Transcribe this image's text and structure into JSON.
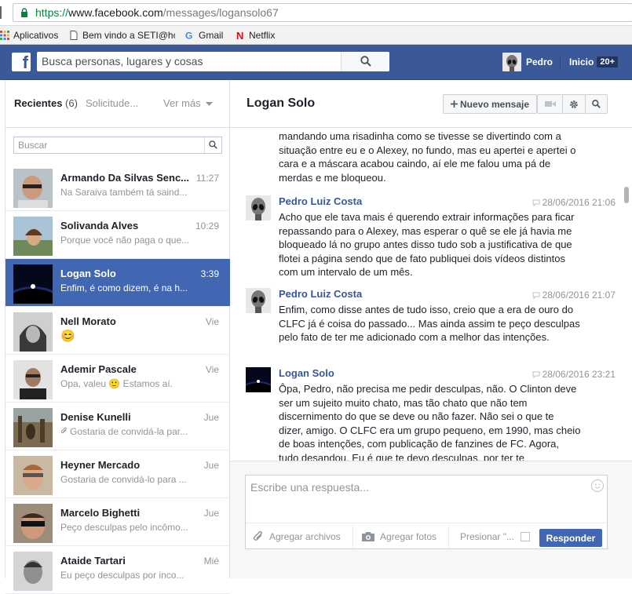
{
  "browser": {
    "url_scheme": "https://",
    "url_host": "www.facebook.com",
    "url_path": "/messages/logansolo67",
    "bookmarks": [
      "Aplicativos",
      "Bem vindo a SETI@hc",
      "Gmail",
      "Netflix"
    ]
  },
  "fb": {
    "search_placeholder": "Busca personas, lugares y cosas",
    "user_name": "Pedro",
    "home_label": "Inicio",
    "home_badge": "20+"
  },
  "left": {
    "tab_recent": "Recientes",
    "tab_recent_count": "(6)",
    "tab_requests": "Solicitude...",
    "tab_more": "Ver más",
    "search_placeholder": "Buscar",
    "threads": [
      {
        "name": "Armando Da Silvas Senc...",
        "time": "11:27",
        "snippet": "Na Saraiva também tá saind..."
      },
      {
        "name": "Solivanda Alves",
        "time": "10:29",
        "snippet": "Porque você não paga o que..."
      },
      {
        "name": "Logan Solo",
        "time": "3:39",
        "snippet": "Enfim, é como dizem, é na h..."
      },
      {
        "name": "Nell Morato",
        "time": "Vie",
        "snippet": "😊"
      },
      {
        "name": "Ademir Pascale",
        "time": "Vie",
        "snippet": "Opa, valeu 🙂 Estamos aí."
      },
      {
        "name": "Denise Kunelli",
        "time": "Jue",
        "snippet": "Gostaria de convidá-la par..."
      },
      {
        "name": "Heyner Mercado",
        "time": "Jue",
        "snippet": "Gostaria de convidá-lo para ..."
      },
      {
        "name": "Marcelo Bighetti",
        "time": "Jue",
        "snippet": "Peço desculpas pelo incômo..."
      },
      {
        "name": "Ataide Tartari",
        "time": "Mié",
        "snippet": "Eu peço desculpas por inco..."
      }
    ]
  },
  "convo": {
    "title": "Logan Solo",
    "new_message": "Nuevo mensaje",
    "messages": [
      {
        "sender": "",
        "time": "",
        "text": "mandando uma risadinha como se tivesse se divertindo com a situação entre eu e o Alexey, no fundo, mas eu apertei e apertei o cara e a máscara acabou caindo, aí ele me falou uma pá de merdas e me bloqueou."
      },
      {
        "sender": "Pedro Luiz Costa",
        "time": "28/06/2016 21:06",
        "text": "Acho que ele tava mais é querendo extrair informações para ficar repassando para o Alexey, mas esperar o quê se ele já havia me bloqueado lá no grupo antes disso tudo sob a justificativa de que flotei a página sendo que de fato publiquei dois vídeos distintos com um intervalo de um mês."
      },
      {
        "sender": "Pedro Luiz Costa",
        "time": "28/06/2016 21:07",
        "text": "Enfim, como disse antes de tudo isso, creio que a era de ouro do CLFC já é coisa do passado... Mas ainda assim te peço desculpas pelo fato de ter me adicionado com a melhor das intenções."
      },
      {
        "sender": "Logan Solo",
        "time": "28/06/2016 23:21",
        "text": "Ôpa, Pedro, não precisa me pedir desculpas, não. O Clinton deve ser um sujeito muito chato, mas tão chato que não tem discernimento do que se deve ou não fazer. Não sei o que te dizer, amigo. O CLFC era um grupo pequeno, em 1990, mas cheio de boas intenções, com publicação de fanzines de FC. Agora, tudo desandou. Eu é que te devo desculpas, por ter te"
      }
    ]
  },
  "composer": {
    "placeholder": "Escribe una respuesta...",
    "attach_label": "Agregar archivos",
    "photos_label": "Agregar fotos",
    "press_enter_label": "Presionar \"...",
    "reply_label": "Responder"
  },
  "colors": {
    "fb_blue": "#3b5998",
    "selected_thread": "#4267b2",
    "link_name": "#365899"
  }
}
